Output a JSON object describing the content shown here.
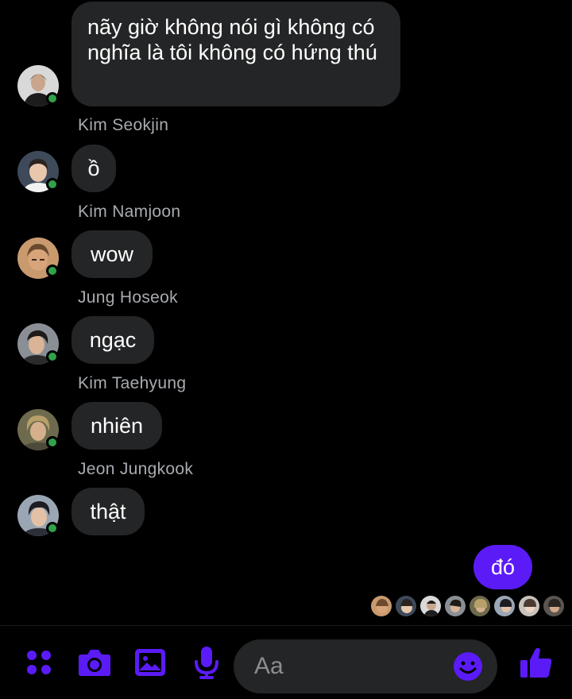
{
  "messages": [
    {
      "sender": "",
      "text": "nãy giờ không nói gì không có nghĩa là tôi không có hứng thú"
    },
    {
      "sender": "Kim Seokjin",
      "text": "ồ"
    },
    {
      "sender": "Kim Namjoon",
      "text": "wow"
    },
    {
      "sender": "Jung Hoseok",
      "text": "ngạc"
    },
    {
      "sender": "Kim Taehyung",
      "text": "nhiên"
    },
    {
      "sender": "Jeon Jungkook",
      "text": "thật"
    }
  ],
  "own_message": {
    "text": "đó"
  },
  "composer": {
    "placeholder": "Aa",
    "icons": [
      "apps-icon",
      "camera-icon",
      "gallery-icon",
      "microphone-icon",
      "emoji-icon",
      "thumbs-up-icon"
    ]
  },
  "read_receipts_count": 8,
  "colors": {
    "accent": "#5b1bf7",
    "bubble": "#242526",
    "background": "#000000",
    "online": "#31a24c",
    "sender_text": "#a8abaf"
  }
}
